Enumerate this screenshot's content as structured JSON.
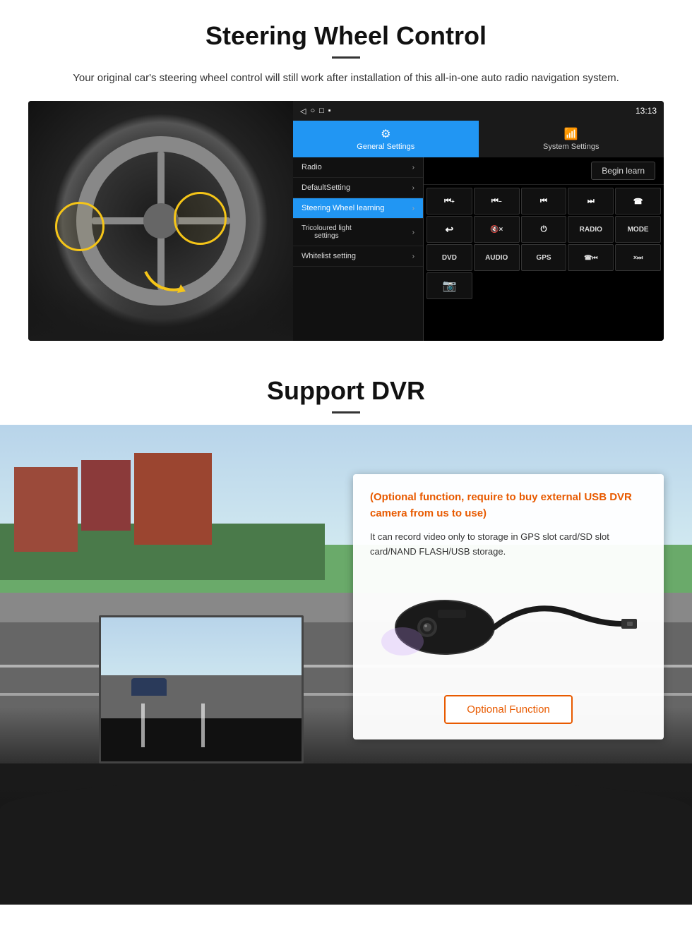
{
  "steering": {
    "title": "Steering Wheel Control",
    "subtitle": "Your original car's steering wheel control will still work after installation of this all-in-one auto radio navigation system.",
    "android": {
      "status_time": "13:13",
      "tab_general": "General Settings",
      "tab_system": "System Settings",
      "menu_items": [
        {
          "label": "Radio",
          "active": false
        },
        {
          "label": "DefaultSetting",
          "active": false
        },
        {
          "label": "Steering Wheel learning",
          "active": true
        },
        {
          "label": "Tricoloured light settings",
          "active": false
        },
        {
          "label": "Whitelist setting",
          "active": false
        }
      ],
      "begin_learn_label": "Begin learn",
      "control_buttons": [
        "⏮+",
        "⏮−",
        "⏮|",
        "|⏭",
        "☎",
        "↩",
        "🔇×",
        "⏻",
        "RADIO",
        "MODE",
        "DVD",
        "AUDIO",
        "GPS",
        "☎⏮|",
        "×⏭"
      ]
    }
  },
  "dvr": {
    "title": "Support DVR",
    "optional_notice": "(Optional function, require to buy external USB DVR camera from us to use)",
    "description": "It can record video only to storage in GPS slot card/SD slot card/NAND FLASH/USB storage.",
    "optional_function_label": "Optional Function"
  }
}
